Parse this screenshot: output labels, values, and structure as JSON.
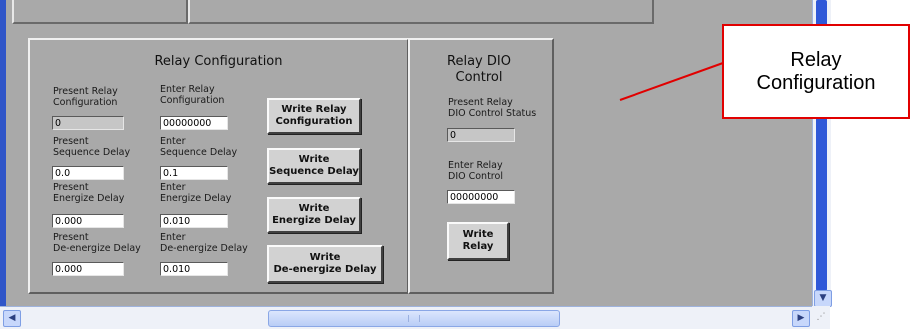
{
  "relay_config": {
    "title": "Relay Configuration",
    "present_config_label": "Present Relay\nConfiguration",
    "present_config_value": "0",
    "enter_config_label": "Enter Relay\nConfiguration",
    "enter_config_value": "00000000",
    "write_config_button": "Write Relay\nConfiguration",
    "present_seq_label": "Present\nSequence Delay",
    "present_seq_value": "0.0",
    "enter_seq_label": "Enter\nSequence Delay",
    "enter_seq_value": "0.1",
    "write_seq_button": "Write\nSequence Delay",
    "present_energize_label": "Present\nEnergize Delay",
    "present_energize_value": "0.000",
    "enter_energize_label": "Enter\nEnergize Delay",
    "enter_energize_value": "0.010",
    "write_energize_button": "Write\nEnergize Delay",
    "present_deenergize_label": "Present\nDe-energize Delay",
    "present_deenergize_value": "0.000",
    "enter_deenergize_label": "Enter\nDe-energize Delay",
    "enter_deenergize_value": "0.010",
    "write_deenergize_button": "Write\nDe-energize Delay"
  },
  "relay_dio": {
    "title": "Relay DIO\nControl",
    "present_status_label": "Present Relay\nDIO Control Status",
    "present_status_value": "0",
    "enter_label": "Enter Relay\nDIO Control",
    "enter_value": "00000000",
    "write_button": "Write\nRelay"
  },
  "callout": {
    "text": "Relay\nConfiguration",
    "border_color": "#e10000"
  },
  "icons": {
    "scroll_left": "scroll-left-arrow-icon",
    "scroll_right": "scroll-right-arrow-icon",
    "scroll_down": "scroll-down-arrow-icon",
    "resize_grip": "resize-grip-icon"
  }
}
